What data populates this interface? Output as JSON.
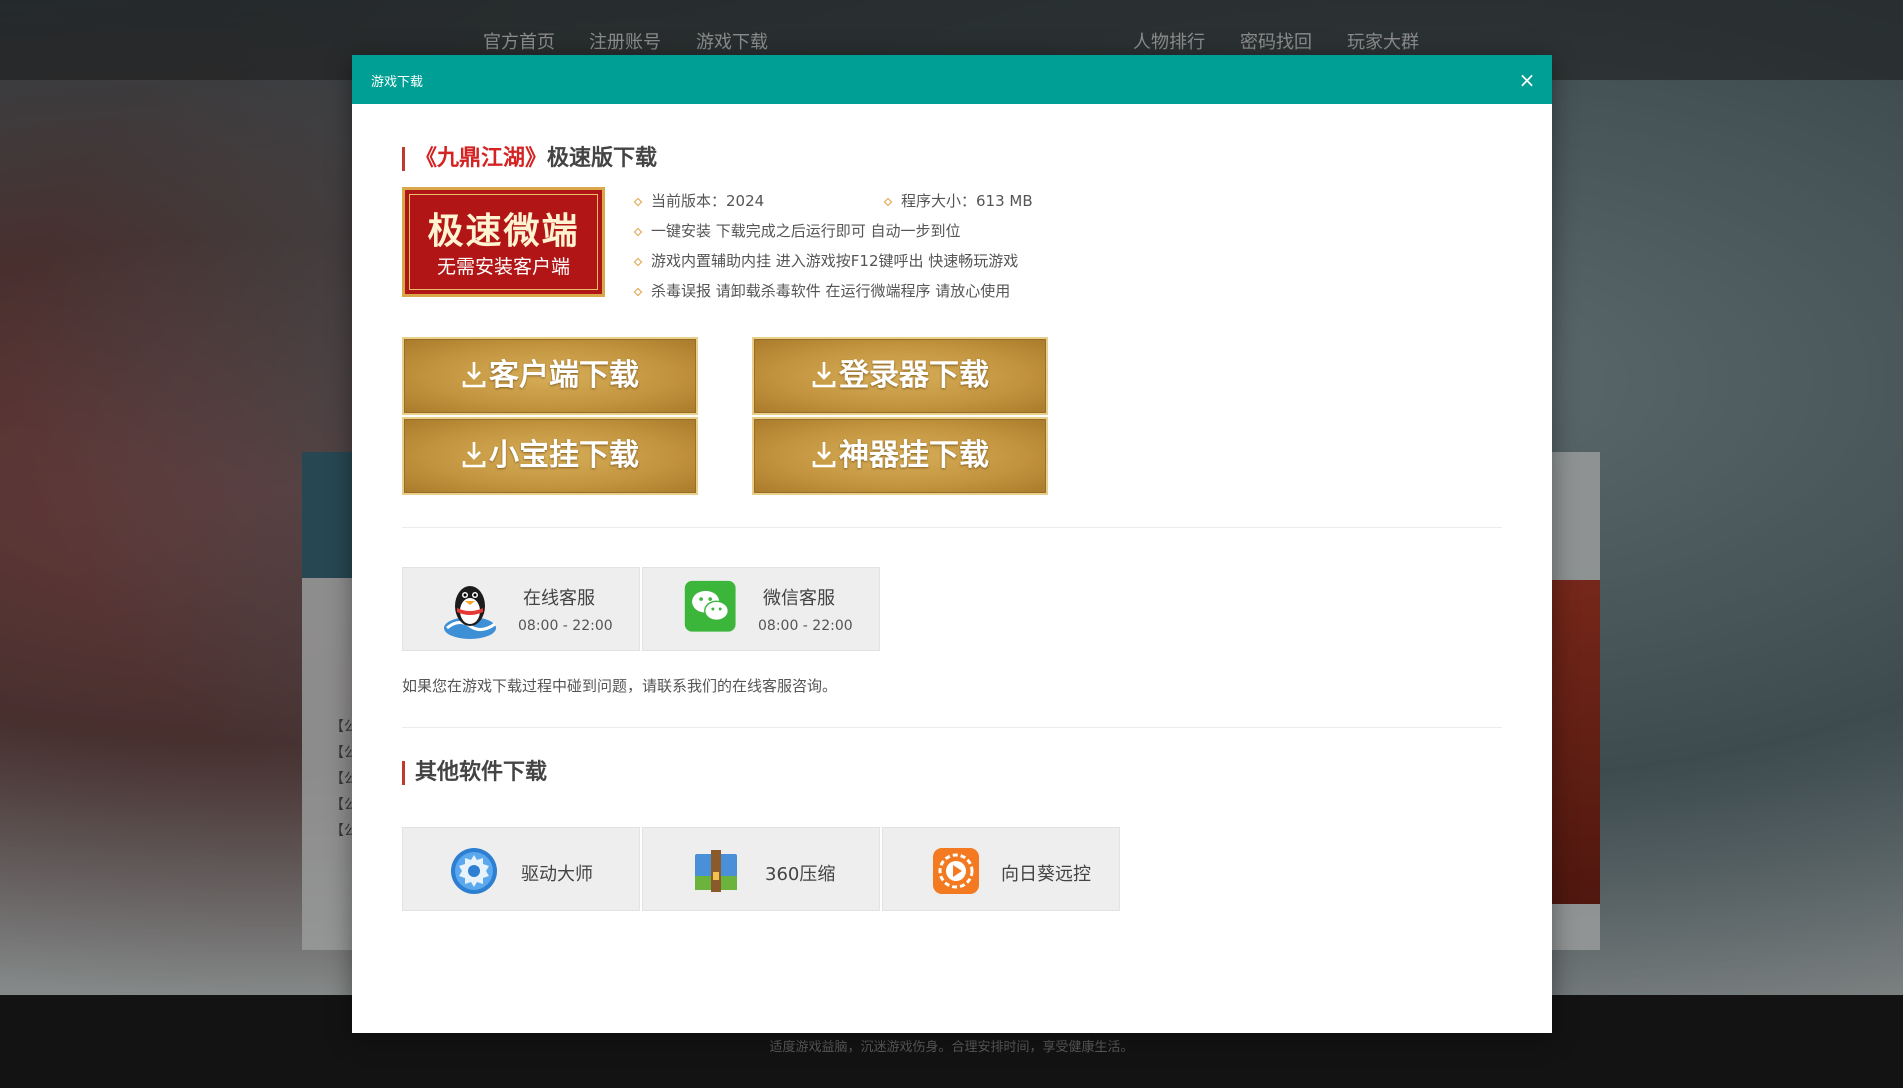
{
  "nav": {
    "home": "官方首页",
    "register": "注册账号",
    "download": "游戏下载",
    "ranking": "人物排行",
    "password": "密码找回",
    "group": "玩家大群"
  },
  "background": {
    "notice_prefix": "【公",
    "footer_text": "适度游戏益脑，沉迷游戏伤身。合理安排时间，享受健康生活。"
  },
  "modal": {
    "title": "游戏下载",
    "close_symbol": "×",
    "section1": {
      "title_prefix": "《九鼎江湖》",
      "title_suffix": "极速版下载"
    },
    "banner": {
      "main": "极速微端",
      "sub": "无需安装客户端"
    },
    "info": {
      "version": "当前版本：2024",
      "size": "程序大小：613 MB",
      "line1": "一键安装 下载完成之后运行即可 自动一步到位",
      "line2": "游戏内置辅助内挂 进入游戏按F12键呼出 快速畅玩游戏",
      "line3": "杀毒误报 请卸载杀毒软件 在运行微端程序 请放心使用"
    },
    "buttons": {
      "client": "客户端下载",
      "launcher": "登录器下载",
      "xiaobao": "小宝挂下载",
      "shenqi": "神器挂下载"
    },
    "service": [
      {
        "name": "在线客服",
        "time": "08:00 - 22:00"
      },
      {
        "name": "微信客服",
        "time": "08:00 - 22:00"
      }
    ],
    "help_text": "如果您在游戏下载过程中碰到问题，请联系我们的在线客服咨询。",
    "section2": {
      "title": "其他软件下载"
    },
    "software": [
      {
        "name": "驱动大师"
      },
      {
        "name": "360压缩"
      },
      {
        "name": "向日葵远控"
      }
    ]
  },
  "colors": {
    "header": "#009f95",
    "accent_red": "#d42323",
    "gold": "#c2933e"
  }
}
